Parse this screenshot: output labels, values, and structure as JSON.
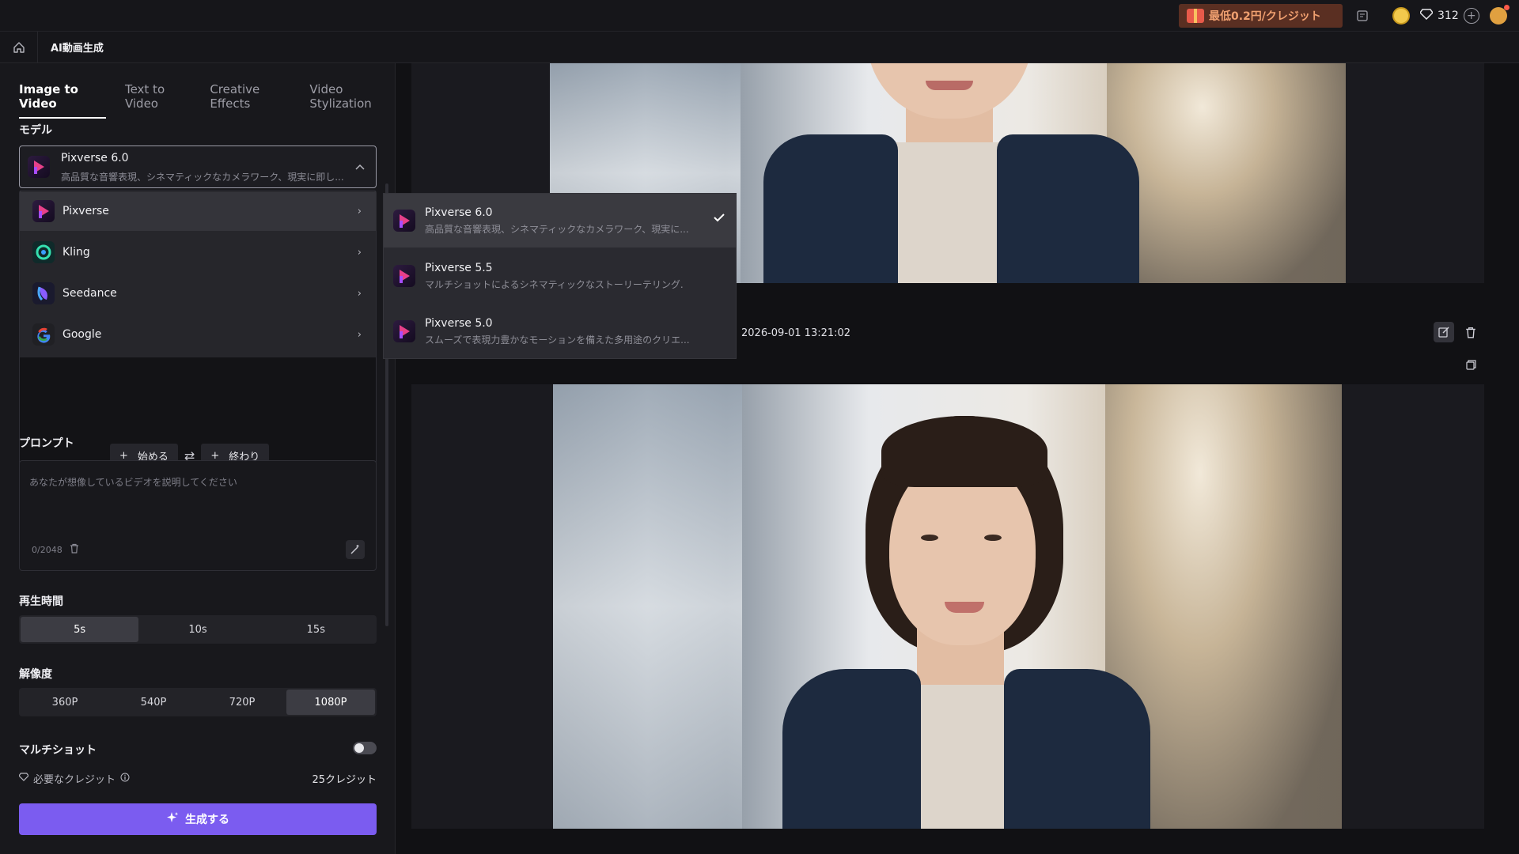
{
  "topbar": {
    "promo_text": "最低0.2円/クレジット",
    "credits": "312",
    "icons": [
      "gift-icon",
      "document-icon",
      "coin-icon",
      "diamond-icon",
      "plus-circle-icon",
      "avatar-icon"
    ]
  },
  "subbar": {
    "title": "AI動画生成"
  },
  "tabs": [
    {
      "label": "Image to Video",
      "active": true
    },
    {
      "label": "Text to Video",
      "active": false
    },
    {
      "label": "Creative Effects",
      "active": false
    },
    {
      "label": "Video Stylization",
      "active": false
    }
  ],
  "model": {
    "section_label": "モデル",
    "selected_name": "Pixverse 6.0",
    "selected_desc": "高品質な音響表現、シネマティックなカメラワーク、現実に即し..."
  },
  "providers": [
    {
      "name": "Pixverse",
      "active": true
    },
    {
      "name": "Kling",
      "active": false
    },
    {
      "name": "Seedance",
      "active": false
    },
    {
      "name": "Google",
      "active": false
    }
  ],
  "submodels": [
    {
      "name": "Pixverse 6.0",
      "desc": "高品質な音響表現、シネマティックなカメラワーク、現実に...",
      "selected": true
    },
    {
      "name": "Pixverse 5.5",
      "desc": "マルチショットによるシネマティックなストーリーテリング.",
      "selected": false
    },
    {
      "name": "Pixverse 5.0",
      "desc": "スムーズで表現力豊かなモーションを備えた多用途のクリエ...",
      "selected": false
    }
  ],
  "frames": {
    "start_label": "始める",
    "end_label": "終わり"
  },
  "prompt": {
    "section_label": "プロンプト",
    "placeholder": "あなたが想像しているビデオを説明してください",
    "count": "0/2048"
  },
  "duration": {
    "section_label": "再生時間",
    "options": [
      "5s",
      "10s",
      "15s"
    ],
    "selected": "5s"
  },
  "resolution": {
    "section_label": "解像度",
    "options": [
      "360P",
      "540P",
      "720P",
      "1080P"
    ],
    "selected": "1080P"
  },
  "multishot": {
    "label": "マルチショット",
    "enabled": false
  },
  "credits": {
    "label": "必要なクレジット",
    "value": "25クレジット"
  },
  "generate": {
    "label": "生成する"
  },
  "result": {
    "timestamp": "2026-09-01 13:21:02"
  },
  "colors": {
    "accent": "#7b5cf0",
    "panel_bg": "#18181c",
    "main_bg": "#111114",
    "promo_text": "#f0a070"
  }
}
